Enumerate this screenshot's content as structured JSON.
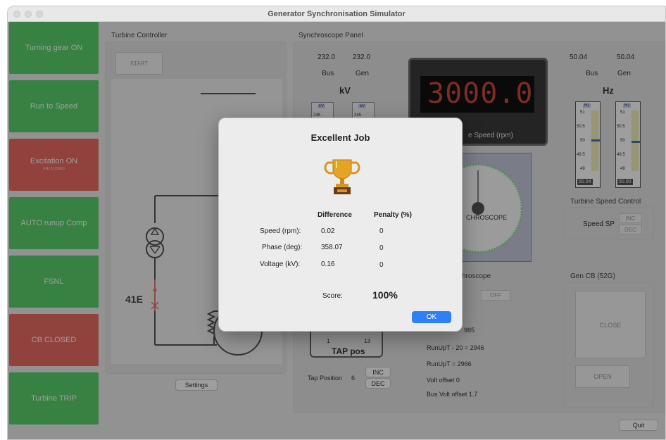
{
  "window": {
    "title": "Generator Synchronisation Simulator"
  },
  "sidebar": {
    "items": [
      {
        "label": "Turning gear ON",
        "sub": ""
      },
      {
        "label": "Run to Speed",
        "sub": ""
      },
      {
        "label": "Excitation ON",
        "sub": "41E CLOSED"
      },
      {
        "label": "AUTO runup Comp",
        "sub": ""
      },
      {
        "label": "FSNL",
        "sub": ""
      },
      {
        "label": "CB CLOSED",
        "sub": ""
      },
      {
        "label": "Turbine TRIP",
        "sub": ""
      }
    ],
    "colors": [
      "#5ad26d",
      "#5ad26d",
      "#ec6b62",
      "#5ad26d",
      "#5ad26d",
      "#ec6b62",
      "#5ad26d"
    ]
  },
  "turbine_controller": {
    "title": "Turbine Controller",
    "start_label": "START",
    "breaker_label": "41E",
    "settings_label": "Settings"
  },
  "synchroscope_panel": {
    "title": "Synchroscope Panel",
    "kv": {
      "bus_value": "232.0",
      "gen_value": "232.0",
      "bus_label": "Bus",
      "gen_label": "Gen",
      "unit": "kV",
      "meter_unit": "kV",
      "meter_tick": "245"
    },
    "speed_display": "3000.0",
    "speed_label": "e Speed (rpm)",
    "synchroscope_label": "CHROSCOPE",
    "synchroscope_section": "hroscope",
    "off_label": "OFF",
    "tap": {
      "label": "TAP pos",
      "tick_1": "1",
      "tick_13": "13",
      "position_label": "Tap Position",
      "position_value": "6",
      "inc": "INC",
      "dec": "DEC"
    },
    "info": {
      "line_0": "985",
      "line_1": "RunUpT - 20 = 2946",
      "line_2": "RunUpT = 2966",
      "line_3": "Volt offset 0",
      "line_4": "Bus Volt offset 1.7"
    }
  },
  "hz": {
    "bus_value": "50.04",
    "gen_value": "50.04",
    "bus_label": "Bus",
    "gen_label": "Gen",
    "unit": "Hz",
    "meter_unit": "Hz",
    "ticks": [
      "51",
      "50.5",
      "50",
      "49.5",
      "49"
    ],
    "bus_readout": "50.04",
    "gen_readout": "50.00",
    "bus_level": 50.04,
    "gen_level": 50.0
  },
  "turbine_speed_control": {
    "title": "Turbine Speed Control",
    "sp_label": "Speed SP",
    "inc": "INC",
    "dec": "DEC"
  },
  "gen_cb": {
    "title": "Gen CB (52G)",
    "close_label": "CLOSE",
    "open_label": "OPEN"
  },
  "quit_label": "Quit",
  "dialog": {
    "title": "Excellent Job",
    "headers": {
      "difference": "Difference",
      "penalty": "Penalty (%)"
    },
    "rows": [
      {
        "label": "Speed (rpm):",
        "difference": "0.02",
        "penalty": "0"
      },
      {
        "label": "Phase (deg):",
        "difference": "358.07",
        "penalty": "0"
      },
      {
        "label": "Voltage (kV):",
        "difference": "0.16",
        "penalty": "0"
      }
    ],
    "score_label": "Score:",
    "score_value": "100%",
    "ok_label": "OK"
  },
  "colors": {
    "accent": "#2f7ff7",
    "green": "#5ad26d",
    "red": "#ec6b62",
    "segment": "#e8523f"
  },
  "icons": {
    "trophy": "trophy-icon"
  }
}
